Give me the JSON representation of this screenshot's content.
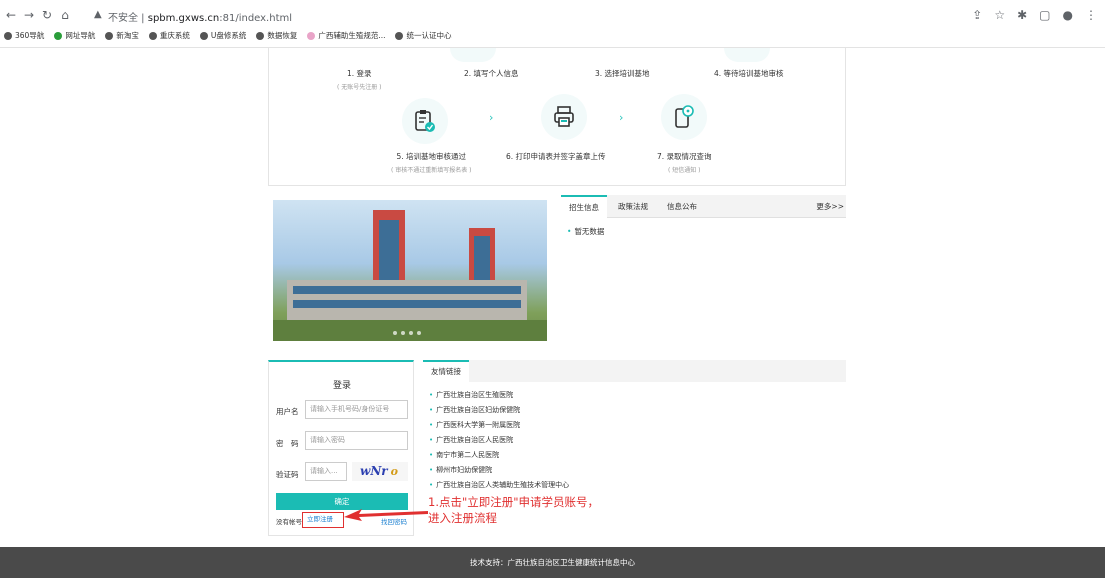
{
  "browser": {
    "security_warning": "不安全",
    "url_host": "spbm.gxws.cn",
    "url_rest": ":81/index.html",
    "bookmarks": [
      "360导航",
      "网址导航",
      "新淘宝",
      "重庆系统",
      "U盘修系统",
      "数据恢复",
      "广西辅助生殖规范...",
      "统一认证中心"
    ]
  },
  "steps": [
    {
      "title": "1. 登录",
      "sub": "( 无账号先注册 )"
    },
    {
      "title": "2. 填写个人信息",
      "sub": ""
    },
    {
      "title": "3. 选择培训基地",
      "sub": ""
    },
    {
      "title": "4. 等待培训基地审核",
      "sub": ""
    },
    {
      "title": "5. 培训基地审核通过",
      "sub": "( 审核不通过重新填写报名表 )"
    },
    {
      "title": "6. 打印申请表并签字盖章上传",
      "sub": ""
    },
    {
      "title": "7. 录取情况查询",
      "sub": "( 短信通知 )"
    }
  ],
  "news": {
    "tabs": [
      "招生信息",
      "政策法规",
      "信息公布"
    ],
    "more": "更多>>",
    "items": [
      "暂无数据"
    ]
  },
  "login": {
    "title": "登录",
    "username_label": "用户名",
    "username_placeholder": "请输入手机号码/身份证号",
    "password_label": "密　码",
    "password_placeholder": "请输入密码",
    "captcha_label": "验证码",
    "captcha_placeholder": "请输入...",
    "captcha_text": "wNr",
    "captcha_extra": "o",
    "submit_label": "确定",
    "no_account_label": "没有帐号",
    "register_link": "立即注册",
    "forgot_link": "找回密码"
  },
  "links": {
    "tab": "友情链接",
    "items": [
      "广西壮族自治区生殖医院",
      "广西壮族自治区妇幼保健院",
      "广西医科大学第一附属医院",
      "广西壮族自治区人民医院",
      "南宁市第二人民医院",
      "柳州市妇幼保健院",
      "广西壮族自治区人类辅助生殖技术管理中心"
    ]
  },
  "annotation": {
    "line1": "1.点击\"立即注册\"申请学员账号，",
    "line2": "进入注册流程"
  },
  "footer": {
    "text": "技术支持：广西壮族自治区卫生健康统计信息中心"
  },
  "colors": {
    "accent": "#1bbcb4",
    "annotation": "#e03030",
    "footer_bg": "#4a4a4a"
  }
}
